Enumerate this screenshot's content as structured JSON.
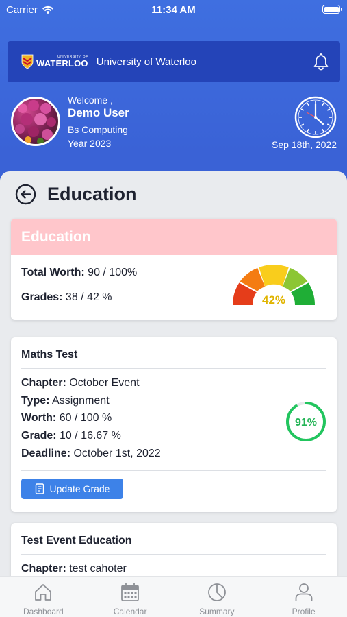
{
  "status_bar": {
    "carrier": "Carrier",
    "time": "11:34 AM"
  },
  "banner": {
    "logo_small": "UNIVERSITY OF",
    "logo_big": "WATERLOO",
    "university_name": "University of Waterloo"
  },
  "profile": {
    "welcome": "Welcome ,",
    "name": "Demo User",
    "program": "Bs Computing",
    "year": "Year 2023",
    "date": "Sep 18th, 2022"
  },
  "page": {
    "title": "Education"
  },
  "summary": {
    "heading": "Education",
    "total_worth_label": "Total Worth:",
    "total_worth_value": "90 / 100%",
    "grades_label": "Grades:",
    "grades_value": "38 / 42 %",
    "gauge_label": "42%",
    "gauge_percent": 42
  },
  "events": [
    {
      "title": "Maths Test",
      "chapter_label": "Chapter:",
      "chapter": "October Event",
      "type_label": "Type:",
      "type": "Assignment",
      "worth_label": "Worth:",
      "worth": "60 / 100 %",
      "grade_label": "Grade:",
      "grade": "10 / 16.67 %",
      "deadline_label": "Deadline:",
      "deadline": "October 1st, 2022",
      "progress_label": "91%",
      "progress_percent": 91,
      "button_label": "Update Grade"
    },
    {
      "title": "Test Event Education",
      "chapter_label": "Chapter:",
      "chapter": "test cahoter"
    }
  ],
  "tabs": [
    {
      "label": "Dashboard",
      "icon": "home-icon"
    },
    {
      "label": "Calendar",
      "icon": "calendar-icon"
    },
    {
      "label": "Summary",
      "icon": "pie-chart-icon"
    },
    {
      "label": "Profile",
      "icon": "person-icon"
    }
  ],
  "colors": {
    "primary": "#3a62d6",
    "banner": "#2444b8",
    "summary_header": "#ffc6cb",
    "button": "#3d82e8",
    "ring_green": "#22c55e",
    "gauge_text": "#e0b400"
  }
}
